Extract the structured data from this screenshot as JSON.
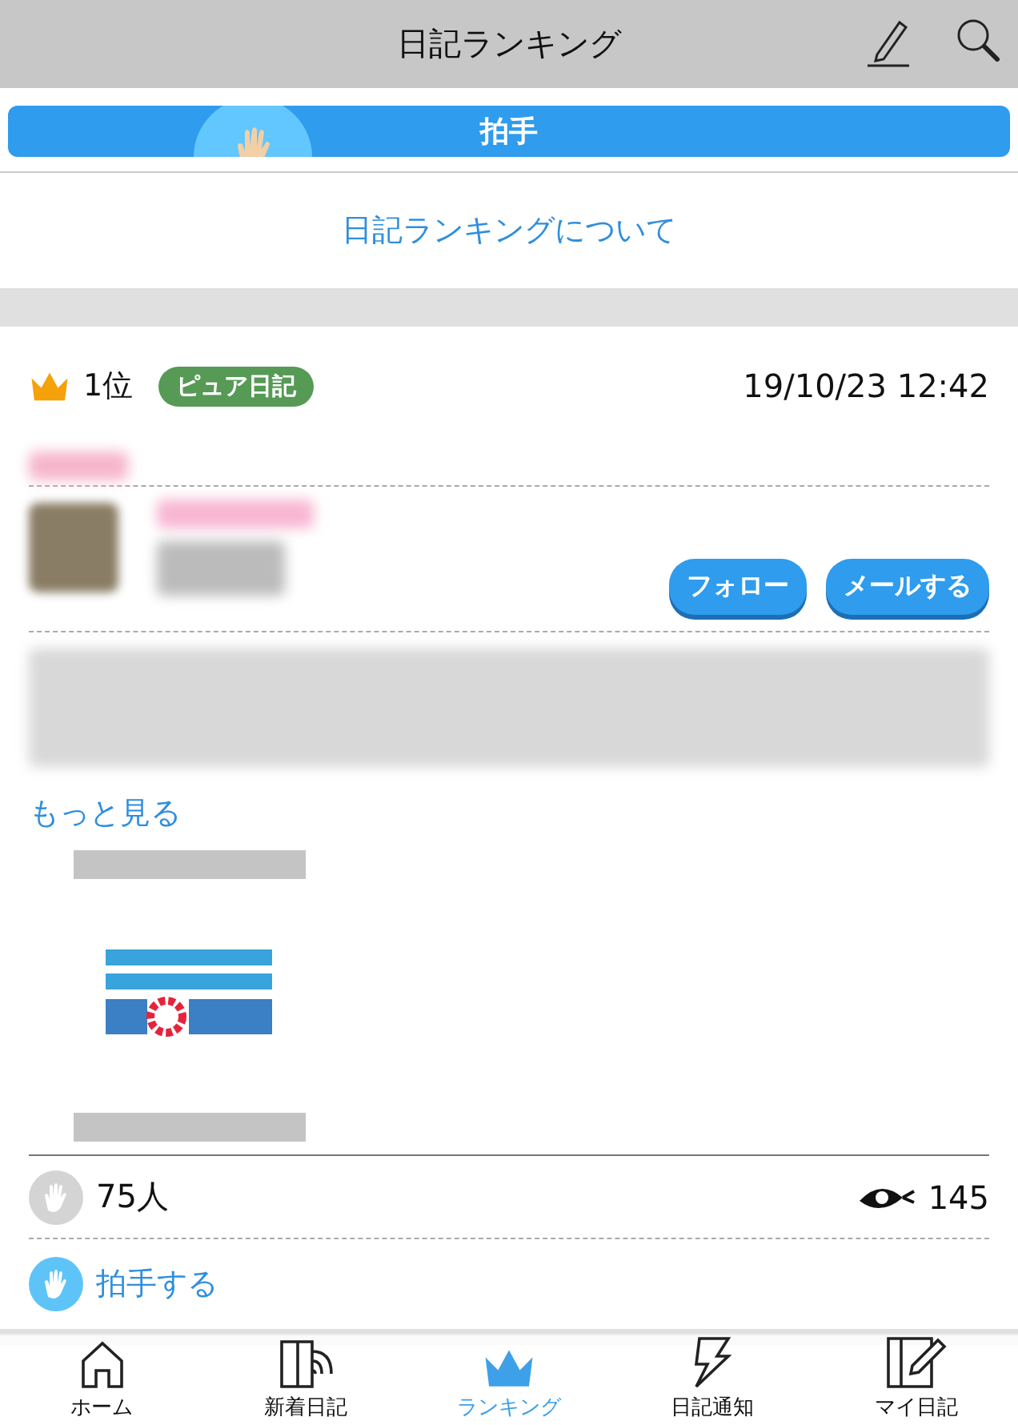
{
  "header": {
    "title": "日記ランキング"
  },
  "clap_banner": {
    "label": "拍手"
  },
  "about_link": "日記ランキングについて",
  "entries": [
    {
      "rank": "1位",
      "badge": "ピュア日記",
      "date": "19/10/23 12:42",
      "follow": "フォロー",
      "mail": "メールする",
      "more": "もっと見る",
      "claps": "75人",
      "views": "145",
      "clap_action": "拍手する"
    }
  ],
  "tab_bar": [
    {
      "label": "ホーム",
      "kind": "home",
      "selected": false
    },
    {
      "label": "新着日記",
      "kind": "new",
      "selected": false
    },
    {
      "label": "ランキング",
      "kind": "ranking",
      "selected": true
    },
    {
      "label": "日記通知",
      "kind": "notify",
      "selected": false
    },
    {
      "label": "マイ日記",
      "kind": "mine",
      "selected": false
    }
  ]
}
